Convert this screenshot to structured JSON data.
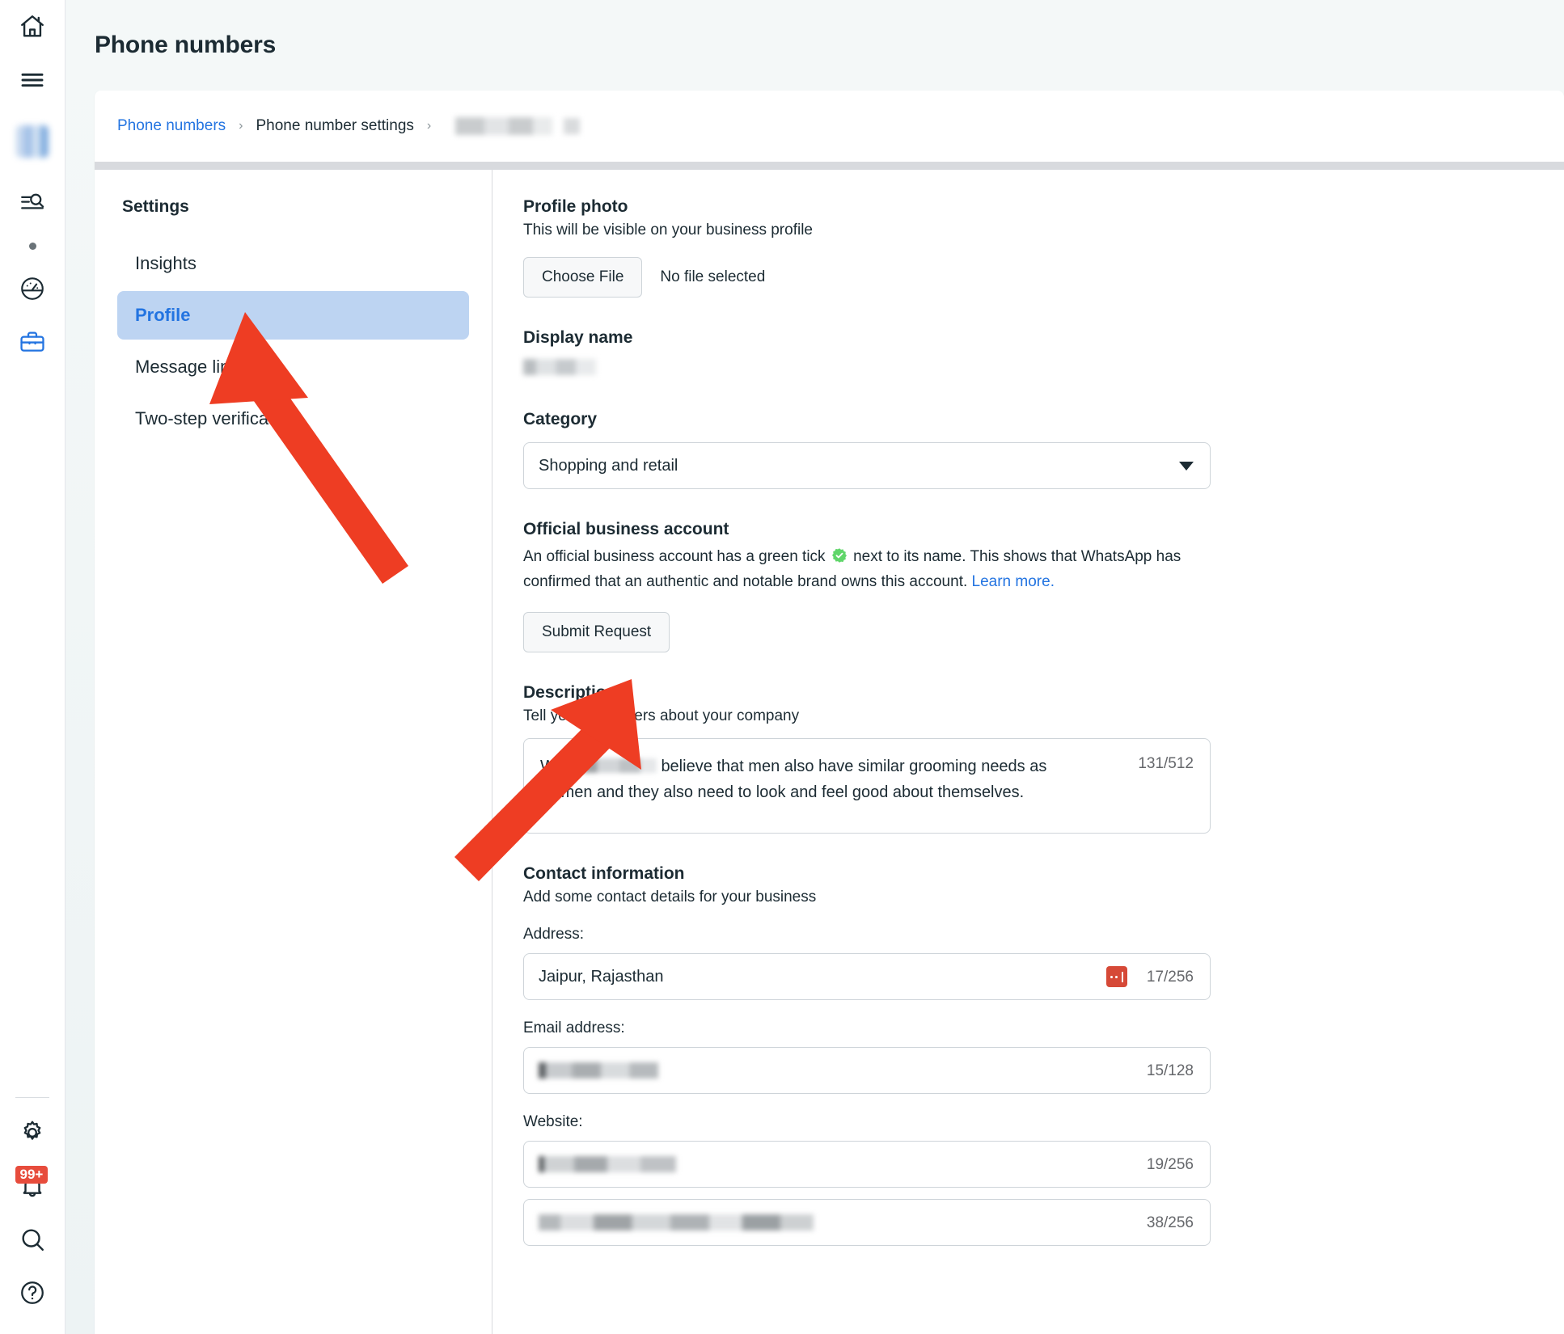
{
  "rail": {
    "icons": [
      {
        "name": "home-icon",
        "label": "Home"
      },
      {
        "name": "menu-icon",
        "label": "Menu"
      },
      {
        "name": "account-avatar",
        "label": "Account"
      },
      {
        "name": "search-list-icon",
        "label": "Search list"
      },
      {
        "name": "status-dot-icon",
        "label": "Status"
      },
      {
        "name": "speedometer-icon",
        "label": "Dashboard"
      },
      {
        "name": "briefcase-icon",
        "label": "Business"
      }
    ],
    "bottom_icons": [
      {
        "name": "gear-icon",
        "label": "Settings"
      },
      {
        "name": "bell-icon",
        "label": "Notifications"
      },
      {
        "name": "search-icon",
        "label": "Search"
      },
      {
        "name": "help-icon",
        "label": "Help"
      }
    ],
    "notification_badge": "99+"
  },
  "header": {
    "title": "Phone numbers"
  },
  "breadcrumb": {
    "items": [
      {
        "label": "Phone numbers",
        "type": "link"
      },
      {
        "label": "Phone number settings",
        "type": "static"
      },
      {
        "label": "",
        "type": "redacted"
      }
    ],
    "separator": "›"
  },
  "settings_nav": {
    "title": "Settings",
    "items": [
      {
        "label": "Insights",
        "active": false
      },
      {
        "label": "Profile",
        "active": true
      },
      {
        "label": "Message links",
        "active": false
      },
      {
        "label": "Two-step verification",
        "active": false
      }
    ]
  },
  "profile": {
    "photo": {
      "title": "Profile photo",
      "subtitle": "This will be visible on your business profile",
      "choose_file_label": "Choose File",
      "file_status": "No file selected"
    },
    "display_name": {
      "title": "Display name",
      "value": ""
    },
    "category": {
      "title": "Category",
      "selected": "Shopping and retail"
    },
    "official_business_account": {
      "title": "Official business account",
      "text_part_1": "An official business account has a green tick",
      "text_part_2": "next to its name. This shows that WhatsApp has confirmed that an authentic and notable brand owns this account.",
      "link_label": "Learn more.",
      "button_label": "Submit Request",
      "tick_color": "#60d66a"
    },
    "description": {
      "title": "Description",
      "subtitle": "Tell your customers about your company",
      "text_before": "We at",
      "text_after": "believe that men also have similar grooming needs as women and they also need to look and feel good about themselves.",
      "counter": "131/512"
    },
    "contact_information": {
      "title": "Contact information",
      "subtitle": "Add some contact details for your business",
      "fields": [
        {
          "label": "Address:",
          "value": "Jaipur, Rajasthan",
          "counter": "17/256",
          "redacted": false,
          "has_chip": true
        },
        {
          "label": "Email address:",
          "value": "",
          "counter": "15/128",
          "redacted": true,
          "has_chip": false
        },
        {
          "label": "Website:",
          "value": "",
          "counter": "19/256",
          "redacted": true,
          "has_chip": false
        },
        {
          "label": "",
          "value": "",
          "counter": "38/256",
          "redacted": true,
          "has_chip": false
        }
      ]
    }
  },
  "annotations": {
    "arrow_color": "#ee3d23",
    "arrows": [
      {
        "name": "arrow-to-profile-nav",
        "points_to": "Profile"
      },
      {
        "name": "arrow-to-submit-request",
        "points_to": "Submit Request"
      }
    ]
  },
  "colors": {
    "accent_blue": "#2374e1",
    "active_nav_bg": "#bdd4f2",
    "text_primary": "#1c2b33",
    "text_muted": "#65676b",
    "danger_red": "#e74c3c"
  }
}
